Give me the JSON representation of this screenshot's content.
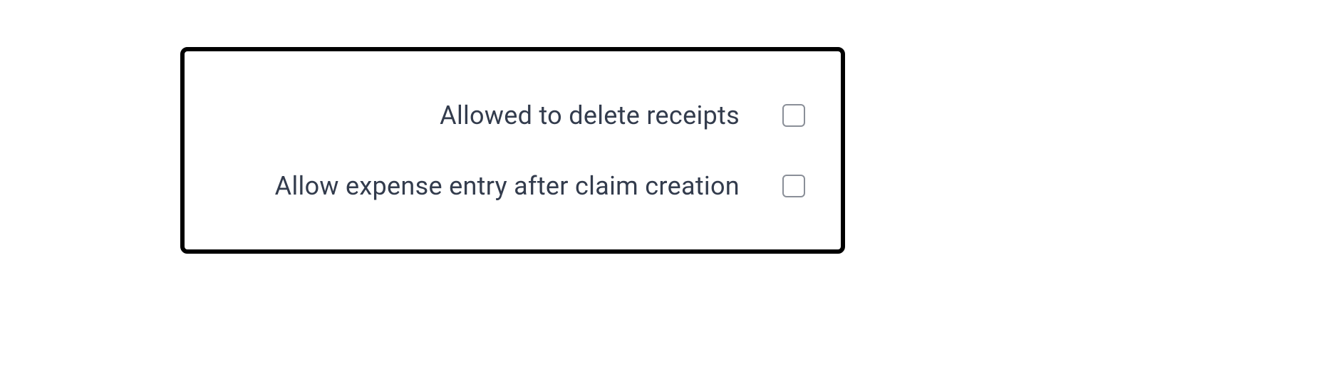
{
  "settings": {
    "options": [
      {
        "label": "Allowed to delete receipts",
        "checked": false
      },
      {
        "label": "Allow expense entry after claim creation",
        "checked": false
      }
    ]
  }
}
